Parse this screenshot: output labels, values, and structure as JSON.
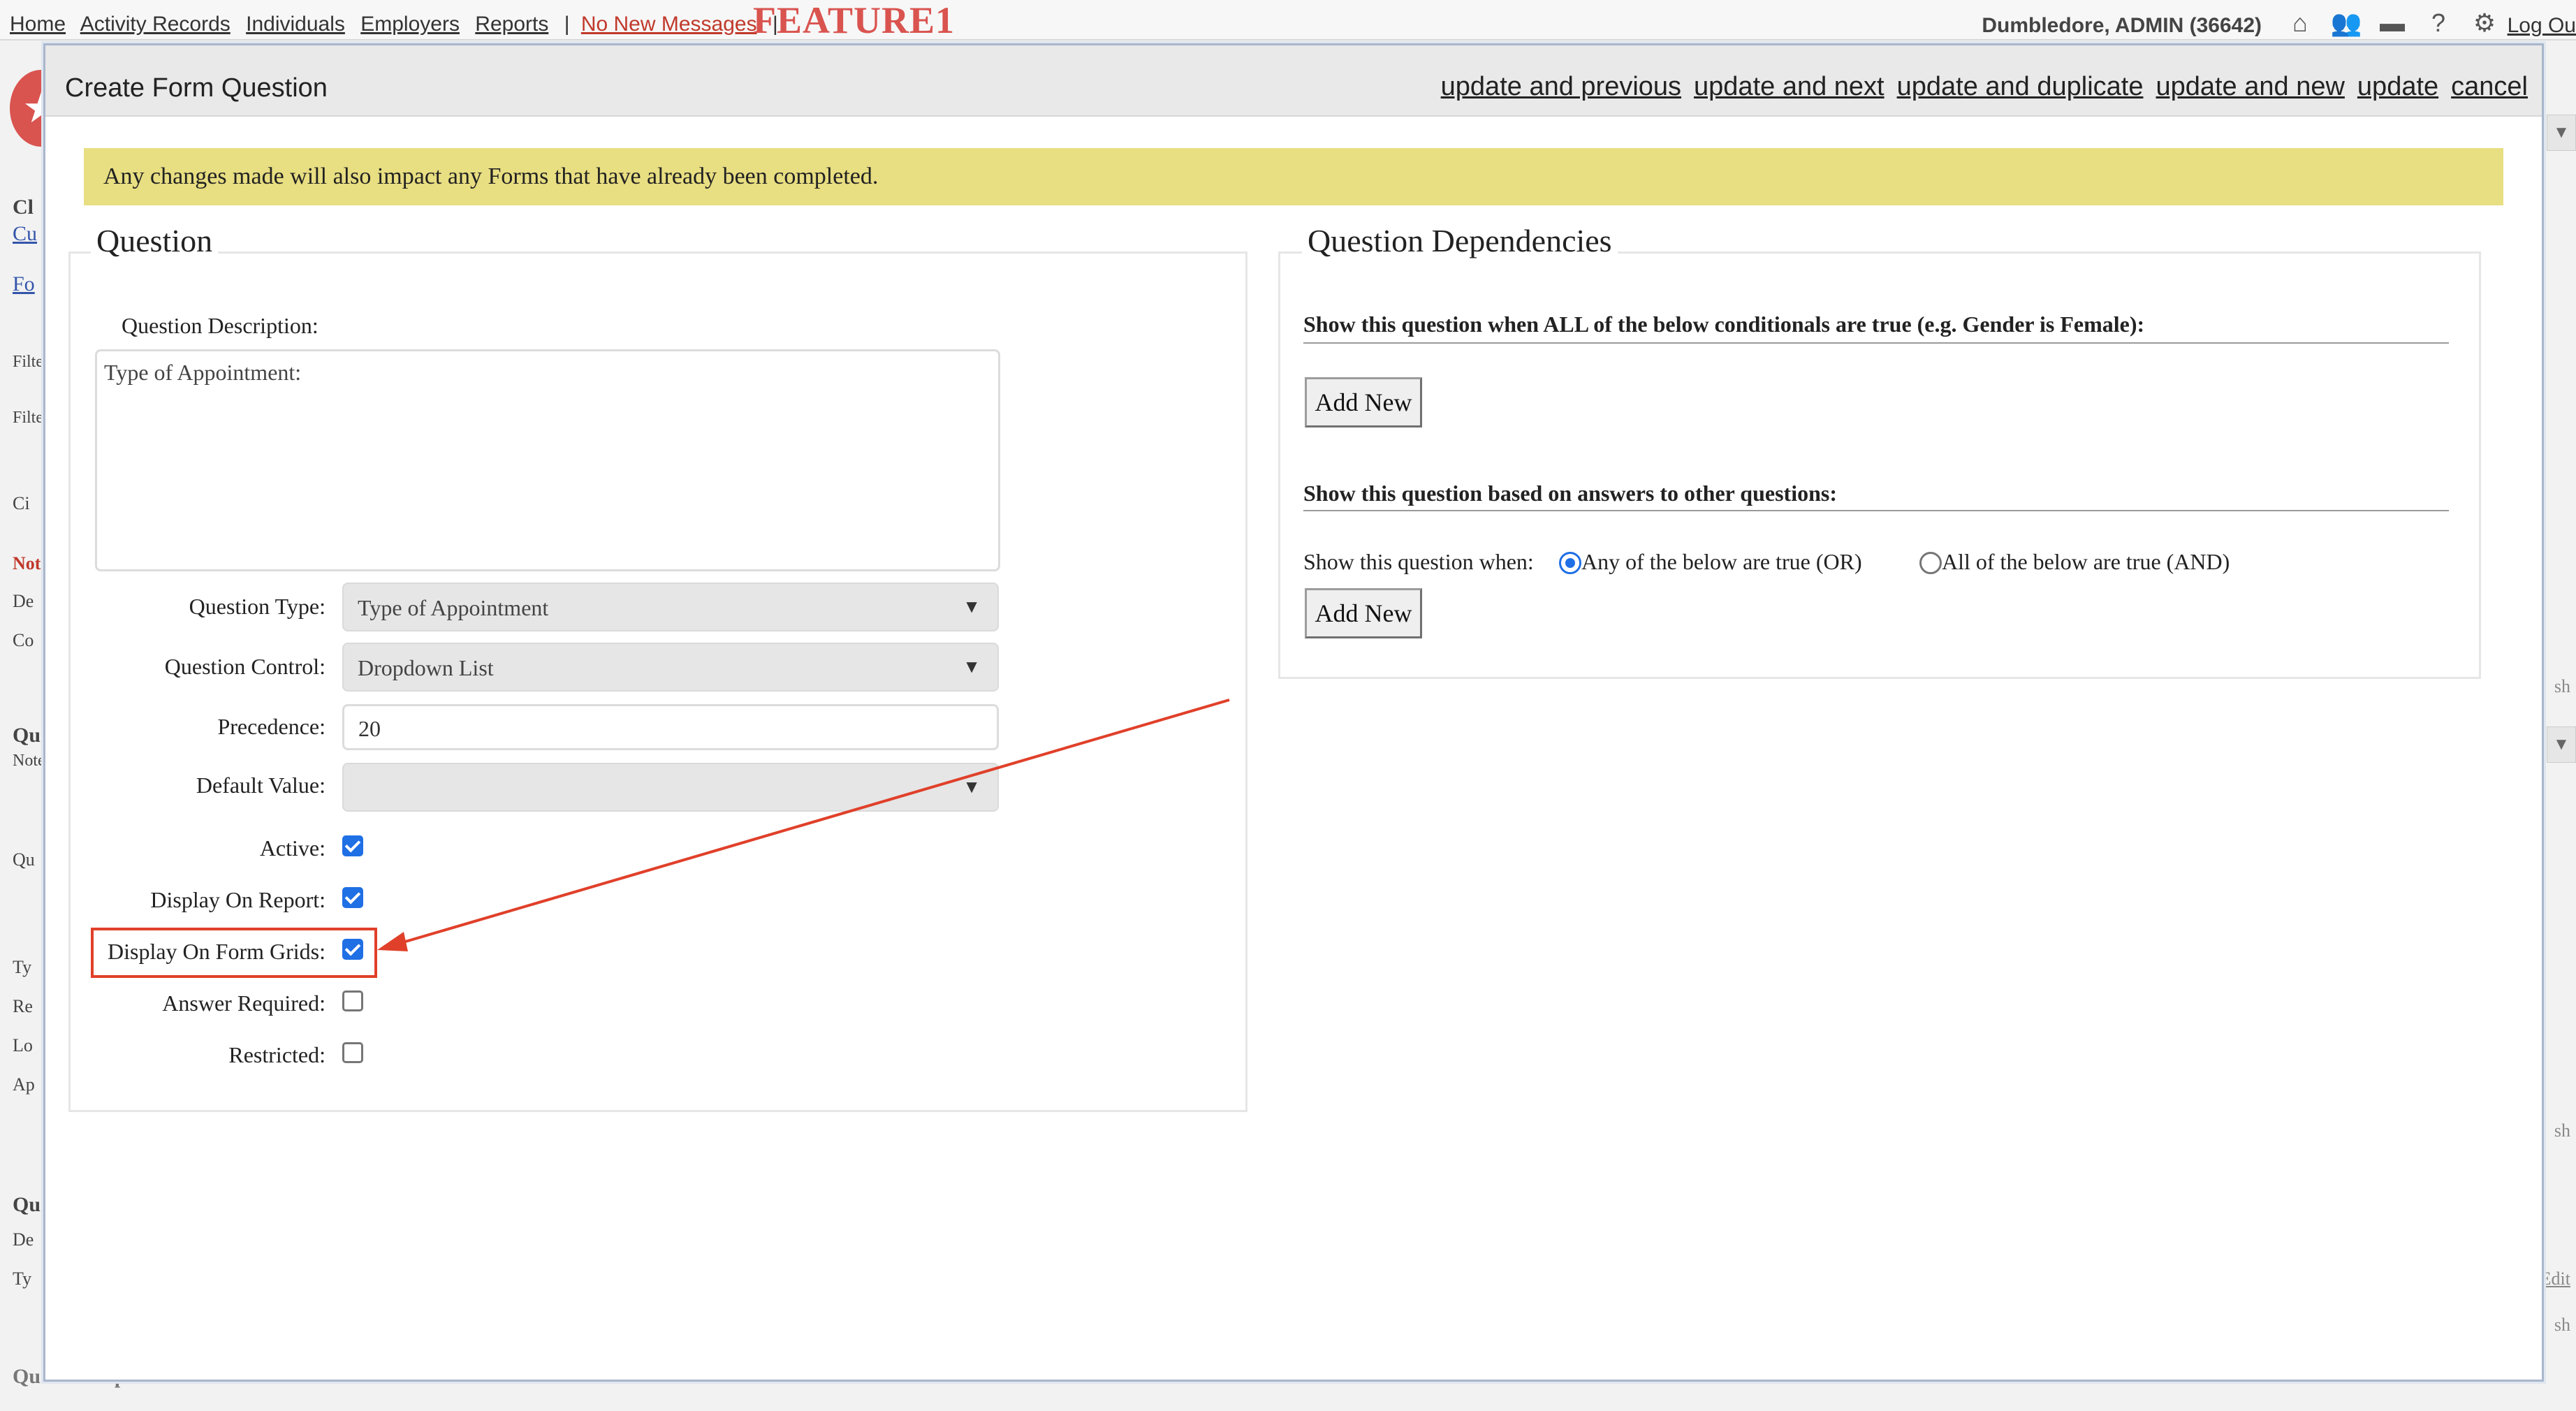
{
  "topnav": {
    "links": [
      "Home",
      "Activity Records",
      "Individuals",
      "Employers",
      "Reports"
    ],
    "messages": "No New Messages",
    "separator": "|",
    "feature_label": "FEATURE1",
    "user": "Dumbledore, ADMIN (36642)",
    "logout": "Log Ou"
  },
  "background": {
    "left_fragments": [
      "Cl",
      "Cu",
      "Fo",
      "Filter",
      "Filter",
      "Ci",
      "Note",
      "De",
      "Co",
      "Que",
      "Note",
      "Qu",
      "Ty",
      "Re",
      "Lo",
      "Ap",
      "Que",
      "De",
      "Ty"
    ],
    "question_options": "Question Options",
    "right_fragments": [
      "sh",
      "sh",
      "Edit",
      "sh"
    ]
  },
  "modal": {
    "title": "Create Form Question",
    "actions": [
      "update and previous",
      "update and next",
      "update and duplicate",
      "update and new",
      "update",
      "cancel"
    ]
  },
  "notice": "Any changes made will also impact any Forms that have already been completed.",
  "question_panel": {
    "legend": "Question",
    "description_label": "Question Description:",
    "description_value": "Type of Appointment:",
    "question_type_label": "Question Type:",
    "question_type_value": "Type of Appointment",
    "question_control_label": "Question Control:",
    "question_control_value": "Dropdown List",
    "precedence_label": "Precedence:",
    "precedence_value": "20",
    "default_value_label": "Default Value:",
    "default_value_value": "",
    "checkboxes": [
      {
        "label": "Active:",
        "checked": true
      },
      {
        "label": "Display On Report:",
        "checked": true
      },
      {
        "label": "Display On Form Grids:",
        "checked": true
      },
      {
        "label": "Answer Required:",
        "checked": false
      },
      {
        "label": "Restricted:",
        "checked": false
      }
    ]
  },
  "dependencies_panel": {
    "legend": "Question Dependencies",
    "all_conditionals_heading": "Show this question when ALL of the below conditionals are true (e.g. Gender is Female):",
    "add_new_label": "Add New",
    "answers_heading": "Show this question based on answers to other questions:",
    "show_when_label": "Show this question when:",
    "radio_or": "Any of the below are true (OR)",
    "radio_and": "All of the below are true (AND)",
    "radio_or_selected": true,
    "add_new_label_2": "Add New"
  },
  "colors": {
    "notice_bg": "#e8de82",
    "accent_blue": "#1f6fe5",
    "annotation_red": "#e0402a",
    "feature_red": "#d9534f"
  }
}
